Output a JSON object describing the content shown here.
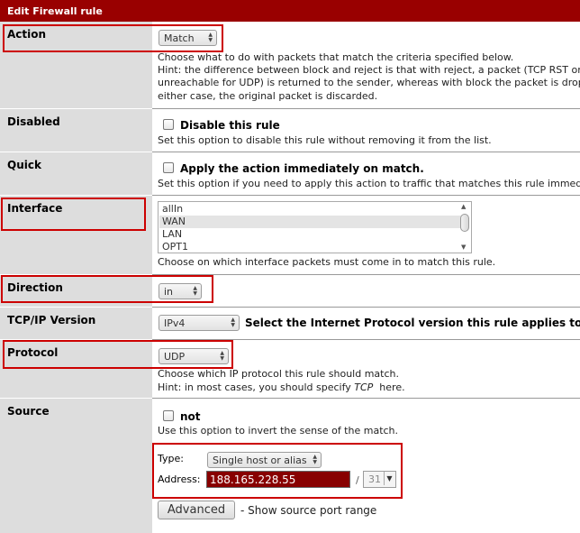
{
  "header": {
    "title": "Edit Firewall rule"
  },
  "action": {
    "label": "Action",
    "value": "Match",
    "help_line1": "Choose what to do with packets that match the criteria specified below.",
    "help_line2": "Hint: the difference between block and reject is that with reject, a packet (TCP RST or ICMP port",
    "help_line3": "unreachable for UDP) is returned to the sender, whereas with block the packet is dropped silently. In",
    "help_line4": "either case, the original packet is discarded."
  },
  "disabled": {
    "label": "Disabled",
    "checkbox_label": "Disable this rule",
    "checked": false,
    "help": "Set this option to disable this rule without removing it from the list."
  },
  "quick": {
    "label": "Quick",
    "checkbox_label": "Apply the action immediately on match.",
    "checked": false,
    "help": "Set this option if you need to apply this action to traffic that matches this rule immediately."
  },
  "interface": {
    "label": "Interface",
    "options": [
      "allIn",
      "WAN",
      "LAN",
      "OPT1"
    ],
    "selected": "WAN",
    "help": "Choose on which interface packets must come in to match this rule."
  },
  "direction": {
    "label": "Direction",
    "value": "in"
  },
  "tcpip": {
    "label": "TCP/IP Version",
    "value": "IPv4",
    "help": "Select the Internet Protocol version this rule applies to"
  },
  "protocol": {
    "label": "Protocol",
    "value": "UDP",
    "help_line1": "Choose which IP protocol this rule should match.",
    "help_pre": "Hint: in most cases, you should specify ",
    "help_em": "TCP",
    "help_post": "  here."
  },
  "source": {
    "label": "Source",
    "not_label": "not",
    "not_checked": false,
    "help": "Use this option to invert the sense of the match.",
    "type_label": "Type:",
    "type_value": "Single host or alias",
    "address_label": "Address:",
    "address_value": "188.165.228.55",
    "slash": "/",
    "mask_value": "31",
    "advanced_button": "Advanced",
    "advanced_help": "- Show source port range"
  },
  "colors": {
    "header_bg": "#990000",
    "highlight": "#cc0000",
    "label_bg": "#dddddd",
    "address_bg": "#880000"
  }
}
